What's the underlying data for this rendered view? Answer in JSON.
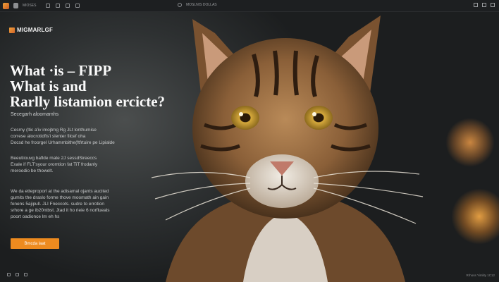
{
  "browser": {
    "tab_label": "MIOSES",
    "address_text": "MOSLNIS DOLLAS"
  },
  "brand": {
    "name": "MIGMARLGF"
  },
  "hero": {
    "title_lines": [
      "What ·is – FIPP",
      "What is and",
      "Rarlly listamion ercicte?"
    ],
    "subtitle": "Secegarh aloomamhs",
    "paragraphs": [
      [
        "Cesmy (ltic a'iv imojtmg Rg JLt lonthumise",
        "correse alocrotidfis'i slenter filcef oha",
        "Docsd he froorgel Urhammbithe(ftfrtuire pe Lipialde"
      ],
      [
        "Beeutiiouvg baflde mate 2J sessdSireeccs",
        "Exale if FLT'syour oromtion fat TiT frodanly",
        "meroodio be thowelt."
      ],
      [
        "We da etteproporl at the adisamal ojants aucited",
        "gumits the draslo forme thove moomath ain gain",
        "fonens 5ajipull. JLI Fneccots. sudre to errotion",
        "srhore a ge ib20ntbst. Jtad it ho rieie 6 norflueals",
        "poort oadionce lm eh hs"
      ]
    ],
    "cta_label": "Bmcda laat",
    "footer_text": "Rrhoss Yimlity 1C12"
  },
  "colors": {
    "accent": "#ee8b1f",
    "background": "#2e3132",
    "text": "#fafafa"
  },
  "icons": {
    "browser_left": [
      "app-logo-icon",
      "document-icon"
    ],
    "toolbar": [
      "grid-icon",
      "heart-icon",
      "image-icon",
      "back-icon"
    ],
    "window": [
      "minimize-icon",
      "maximize-icon",
      "close-icon"
    ],
    "footer": [
      "settings-icon",
      "wifi-icon",
      "notification-icon"
    ]
  }
}
